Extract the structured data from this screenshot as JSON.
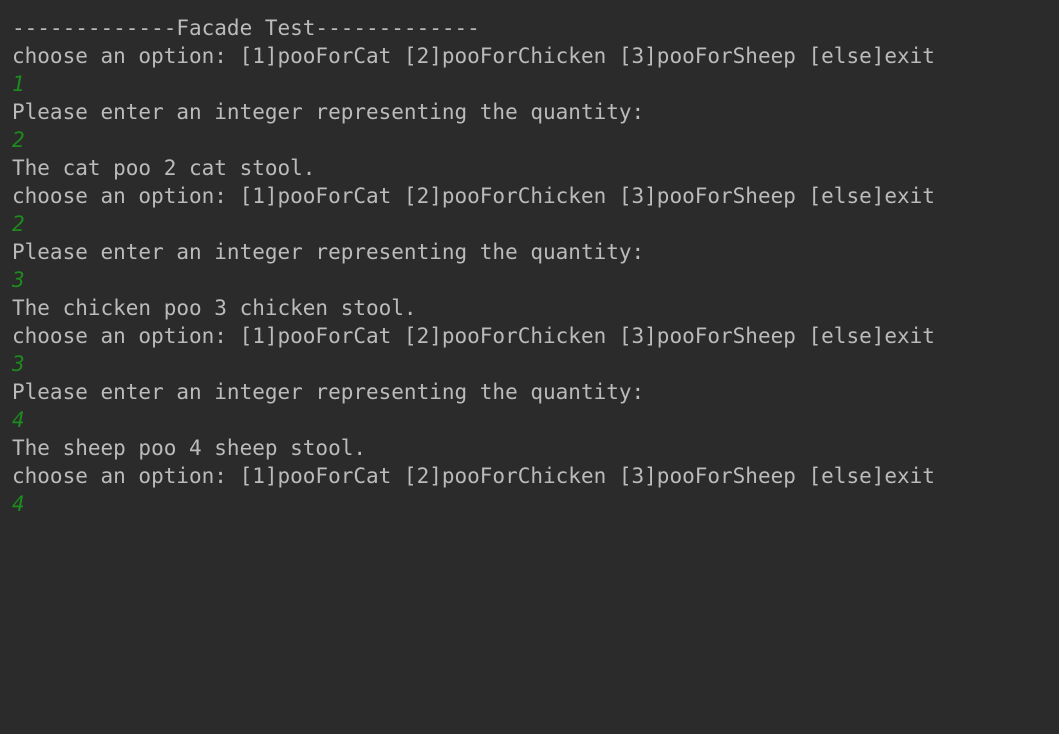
{
  "console": {
    "colors": {
      "background": "#2b2b2b",
      "output_text": "#bbbbbb",
      "user_input_text": "#1e8a1e"
    },
    "lines": [
      {
        "type": "output",
        "text": "-------------Facade Test-------------"
      },
      {
        "type": "output",
        "text": "choose an option: [1]pooForCat [2]pooForChicken [3]pooForSheep [else]exit"
      },
      {
        "type": "input",
        "text": "1"
      },
      {
        "type": "output",
        "text": "Please enter an integer representing the quantity:"
      },
      {
        "type": "input",
        "text": "2"
      },
      {
        "type": "output",
        "text": "The cat poo 2 cat stool."
      },
      {
        "type": "output",
        "text": "choose an option: [1]pooForCat [2]pooForChicken [3]pooForSheep [else]exit"
      },
      {
        "type": "input",
        "text": "2"
      },
      {
        "type": "output",
        "text": "Please enter an integer representing the quantity:"
      },
      {
        "type": "input",
        "text": "3"
      },
      {
        "type": "output",
        "text": "The chicken poo 3 chicken stool."
      },
      {
        "type": "output",
        "text": "choose an option: [1]pooForCat [2]pooForChicken [3]pooForSheep [else]exit"
      },
      {
        "type": "input",
        "text": "3"
      },
      {
        "type": "output",
        "text": "Please enter an integer representing the quantity:"
      },
      {
        "type": "input",
        "text": "4"
      },
      {
        "type": "output",
        "text": "The sheep poo 4 sheep stool."
      },
      {
        "type": "output",
        "text": "choose an option: [1]pooForCat [2]pooForChicken [3]pooForSheep [else]exit"
      },
      {
        "type": "input",
        "text": "4"
      }
    ]
  }
}
